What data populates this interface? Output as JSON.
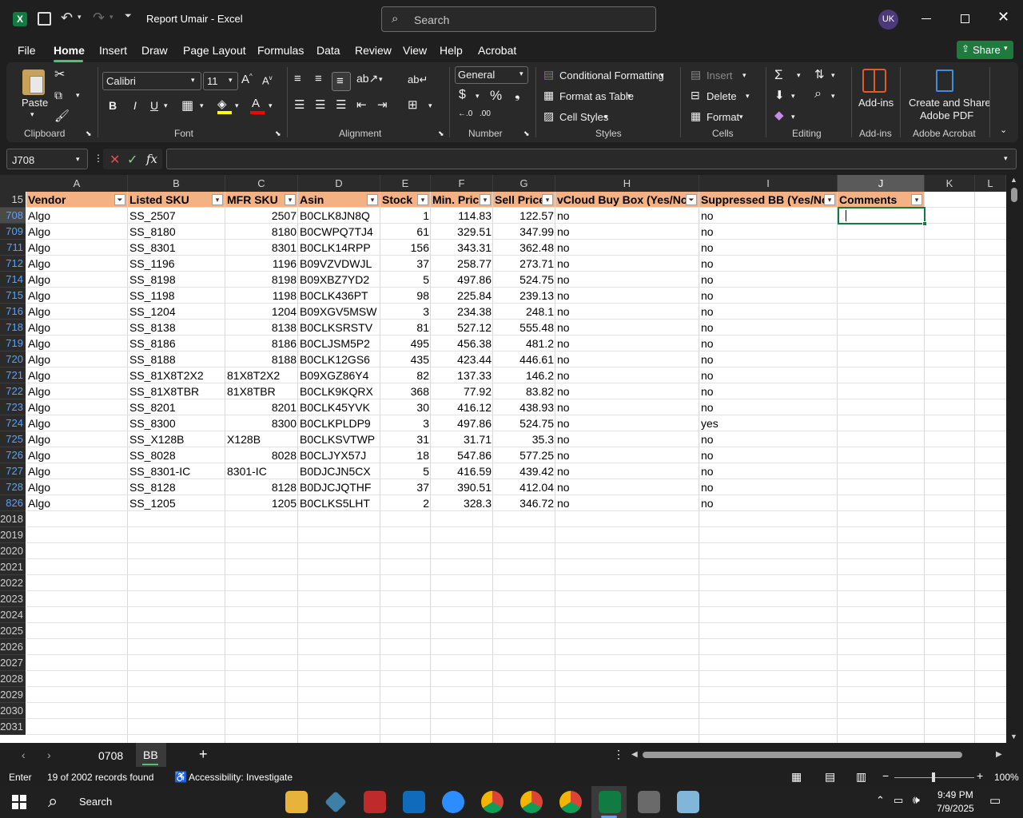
{
  "title_bar": {
    "doc_title": "Report Umair  -  Excel",
    "search_placeholder": "Search",
    "avatar": "UK"
  },
  "menu": {
    "items": [
      "File",
      "Home",
      "Insert",
      "Draw",
      "Page Layout",
      "Formulas",
      "Data",
      "Review",
      "View",
      "Help",
      "Acrobat"
    ],
    "active": "Home",
    "share_label": "Share"
  },
  "ribbon": {
    "clipboard": {
      "paste": "Paste",
      "label": "Clipboard"
    },
    "font": {
      "name": "Calibri",
      "size": "11",
      "label": "Font"
    },
    "alignment": {
      "label": "Alignment"
    },
    "number": {
      "format": "General",
      "label": "Number"
    },
    "styles": {
      "conditional": "Conditional Formatting",
      "table": "Format as Table",
      "cell_styles": "Cell Styles",
      "label": "Styles"
    },
    "cells": {
      "insert": "Insert",
      "delete": "Delete",
      "format": "Format",
      "label": "Cells"
    },
    "editing": {
      "label": "Editing"
    },
    "addins": {
      "btn": "Add-ins",
      "label": "Add-ins"
    },
    "acrobat": {
      "line1": "Create and Share",
      "line2": "Adobe PDF",
      "label": "Adobe Acrobat"
    }
  },
  "formula_bar": {
    "name_box": "J708",
    "fx": "fx",
    "content": ""
  },
  "columns": [
    "A",
    "B",
    "C",
    "D",
    "E",
    "F",
    "G",
    "H",
    "I",
    "J",
    "K",
    "L"
  ],
  "header_row_number": "15",
  "table_headers": [
    "Vendor",
    "Listed SKU",
    "MFR SKU",
    "Asin",
    "Stock",
    "Min. Pric",
    "Sell Price",
    "vCloud Buy Box (Yes/No",
    "Suppressed BB (Yes/No",
    "Comments"
  ],
  "rows": [
    {
      "n": "708",
      "a": "Algo",
      "b": "SS_2507",
      "c": "2507",
      "d": "B0CLK8JN8Q",
      "e": "1",
      "f": "114.83",
      "g": "122.57",
      "h": "no",
      "i": "no"
    },
    {
      "n": "709",
      "a": "Algo",
      "b": "SS_8180",
      "c": "8180",
      "d": "B0CWPQ7TJ4",
      "e": "61",
      "f": "329.51",
      "g": "347.99",
      "h": "no",
      "i": "no"
    },
    {
      "n": "711",
      "a": "Algo",
      "b": "SS_8301",
      "c": "8301",
      "d": "B0CLK14RPP",
      "e": "156",
      "f": "343.31",
      "g": "362.48",
      "h": "no",
      "i": "no"
    },
    {
      "n": "712",
      "a": "Algo",
      "b": "SS_1196",
      "c": "1196",
      "d": "B09VZVDWJL",
      "e": "37",
      "f": "258.77",
      "g": "273.71",
      "h": "no",
      "i": "no"
    },
    {
      "n": "714",
      "a": "Algo",
      "b": "SS_8198",
      "c": "8198",
      "d": "B09XBZ7YD2",
      "e": "5",
      "f": "497.86",
      "g": "524.75",
      "h": "no",
      "i": "no"
    },
    {
      "n": "715",
      "a": "Algo",
      "b": "SS_1198",
      "c": "1198",
      "d": "B0CLK436PT",
      "e": "98",
      "f": "225.84",
      "g": "239.13",
      "h": "no",
      "i": "no"
    },
    {
      "n": "716",
      "a": "Algo",
      "b": "SS_1204",
      "c": "1204",
      "d": "B09XGV5MSW",
      "e": "3",
      "f": "234.38",
      "g": "248.1",
      "h": "no",
      "i": "no"
    },
    {
      "n": "718",
      "a": "Algo",
      "b": "SS_8138",
      "c": "8138",
      "d": "B0CLKSRSTV",
      "e": "81",
      "f": "527.12",
      "g": "555.48",
      "h": "no",
      "i": "no"
    },
    {
      "n": "719",
      "a": "Algo",
      "b": "SS_8186",
      "c": "8186",
      "d": "B0CLJSM5P2",
      "e": "495",
      "f": "456.38",
      "g": "481.2",
      "h": "no",
      "i": "no"
    },
    {
      "n": "720",
      "a": "Algo",
      "b": "SS_8188",
      "c": "8188",
      "d": "B0CLK12GS6",
      "e": "435",
      "f": "423.44",
      "g": "446.61",
      "h": "no",
      "i": "no"
    },
    {
      "n": "721",
      "a": "Algo",
      "b": "SS_81X8T2X2",
      "c": "81X8T2X2",
      "d": "B09XGZ86Y4",
      "e": "82",
      "f": "137.33",
      "g": "146.2",
      "h": "no",
      "i": "no",
      "ctext": true
    },
    {
      "n": "722",
      "a": "Algo",
      "b": "SS_81X8TBR",
      "c": "81X8TBR",
      "d": "B0CLK9KQRX",
      "e": "368",
      "f": "77.92",
      "g": "83.82",
      "h": "no",
      "i": "no",
      "ctext": true
    },
    {
      "n": "723",
      "a": "Algo",
      "b": "SS_8201",
      "c": "8201",
      "d": "B0CLK45YVK",
      "e": "30",
      "f": "416.12",
      "g": "438.93",
      "h": "no",
      "i": "no"
    },
    {
      "n": "724",
      "a": "Algo",
      "b": "SS_8300",
      "c": "8300",
      "d": "B0CLKPLDP9",
      "e": "3",
      "f": "497.86",
      "g": "524.75",
      "h": "no",
      "i": "yes"
    },
    {
      "n": "725",
      "a": "Algo",
      "b": "SS_X128B",
      "c": "X128B",
      "d": "B0CLKSVTWP",
      "e": "31",
      "f": "31.71",
      "g": "35.3",
      "h": "no",
      "i": "no",
      "ctext": true
    },
    {
      "n": "726",
      "a": "Algo",
      "b": "SS_8028",
      "c": "8028",
      "d": "B0CLJYX57J",
      "e": "18",
      "f": "547.86",
      "g": "577.25",
      "h": "no",
      "i": "no"
    },
    {
      "n": "727",
      "a": "Algo",
      "b": "SS_8301-IC",
      "c": "8301-IC",
      "d": "B0DJCJN5CX",
      "e": "5",
      "f": "416.59",
      "g": "439.42",
      "h": "no",
      "i": "no",
      "ctext": true
    },
    {
      "n": "728",
      "a": "Algo",
      "b": "SS_8128",
      "c": "8128",
      "d": "B0DJCJQTHF",
      "e": "37",
      "f": "390.51",
      "g": "412.04",
      "h": "no",
      "i": "no"
    },
    {
      "n": "826",
      "a": "Algo",
      "b": "SS_1205",
      "c": "1205",
      "d": "B0CLKS5LHT",
      "e": "2",
      "f": "328.3",
      "g": "346.72",
      "h": "no",
      "i": "no"
    }
  ],
  "empty_rows": [
    "2018",
    "2019",
    "2020",
    "2021",
    "2022",
    "2023",
    "2024",
    "2025",
    "2026",
    "2027",
    "2028",
    "2029",
    "2030",
    "2031"
  ],
  "sheet_tabs": [
    "0708",
    "BB"
  ],
  "active_sheet": "BB",
  "status": {
    "mode": "Enter",
    "records": "19 of 2002 records found",
    "accessibility": "Accessibility: Investigate",
    "zoom": "100%"
  },
  "taskbar": {
    "search": "Search",
    "time": "9:49 PM",
    "date": "7/9/2025"
  },
  "colors": {
    "header_fill": "#f4b183",
    "excel_green": "#107c41",
    "share_green": "#1e7b3d",
    "accent_blue": "#5aa0ff"
  }
}
